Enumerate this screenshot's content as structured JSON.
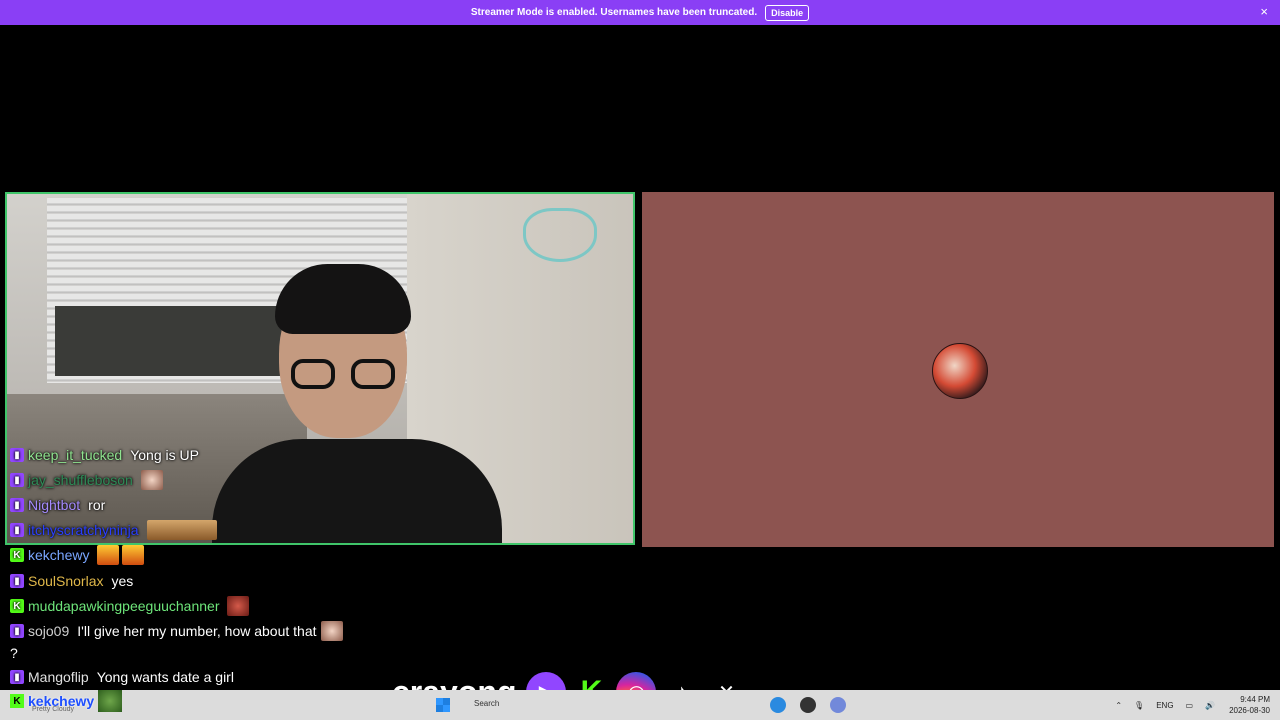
{
  "banner": {
    "message": "Streamer Mode is enabled. Usernames have been truncated.",
    "disable_label": "Disable",
    "close_icon": "×"
  },
  "chat": [
    {
      "platform": "twitch",
      "user": "keep_it_tucked",
      "user_color": "#8fe38f",
      "text": "Yong is UP",
      "emotes": []
    },
    {
      "platform": "twitch",
      "user": "jay_shuffleboson",
      "user_color": "#2e8b57",
      "text": "",
      "emotes": [
        "face"
      ]
    },
    {
      "platform": "twitch",
      "user": "Nightbot",
      "user_color": "#a58bff",
      "text": "ror",
      "emotes": []
    },
    {
      "platform": "twitch",
      "user": "itchyscratchyninja",
      "user_color": "#2a3fff",
      "text": "",
      "emotes": [
        "pizza"
      ]
    },
    {
      "platform": "kick",
      "user": "kekchewy",
      "user_color": "#7aa6ff",
      "text": "",
      "emotes": [
        "fire",
        "fire"
      ]
    },
    {
      "platform": "twitch",
      "user": "SoulSnorlax",
      "user_color": "#e0b84a",
      "text": "yes",
      "emotes": []
    },
    {
      "platform": "kick",
      "user": "muddapawkingpeeguuchanner",
      "user_color": "#6ee57a",
      "text": "",
      "emotes": [
        "red"
      ]
    },
    {
      "platform": "twitch",
      "user": "sojo09",
      "user_color": "#cfcfcf",
      "text": "I'll give her my number, how about that",
      "emotes": [
        "face"
      ]
    },
    {
      "platform": "none",
      "user": "",
      "user_color": "#ffffff",
      "text": "?",
      "emotes": []
    },
    {
      "platform": "twitch",
      "user": "Mangoflip",
      "user_color": "#e0e0e0",
      "text": "Yong wants date a girl",
      "emotes": []
    }
  ],
  "bottom_chat": {
    "user": "kekchewy",
    "sub": "Pretty Cloudy"
  },
  "social": {
    "brand": "crayong",
    "icons": [
      "twitch-icon",
      "kick-icon",
      "instagram-icon",
      "tiktok-icon",
      "x-icon"
    ]
  },
  "taskbar": {
    "search_label": "Search",
    "language": "ENG",
    "time": "9:44 PM",
    "date": "2026-08-30"
  },
  "colors": {
    "banner_bg": "#8a3ff5",
    "tile_border": "#40c56a",
    "right_tile_bg": "#8d5450"
  }
}
